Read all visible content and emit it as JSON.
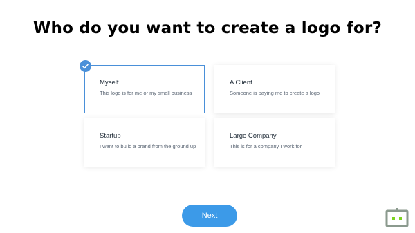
{
  "heading": "Who do you want to create a logo for?",
  "options": [
    {
      "title": "Myself",
      "description": "This logo is for me or my small business",
      "selected": true
    },
    {
      "title": "A Client",
      "description": "Someone is paying me to create a logo",
      "selected": false
    },
    {
      "title": "Startup",
      "description": "I want to build a brand from the ground up",
      "selected": false
    },
    {
      "title": "Large Company",
      "description": "This is for a company I work for",
      "selected": false
    }
  ],
  "next_label": "Next",
  "colors": {
    "accent": "#4a90d9",
    "button": "#3c9ae8",
    "robot": "#8b9a8e"
  },
  "icons": {
    "selected_badge": "checkmark-icon",
    "corner": "robot-icon"
  }
}
